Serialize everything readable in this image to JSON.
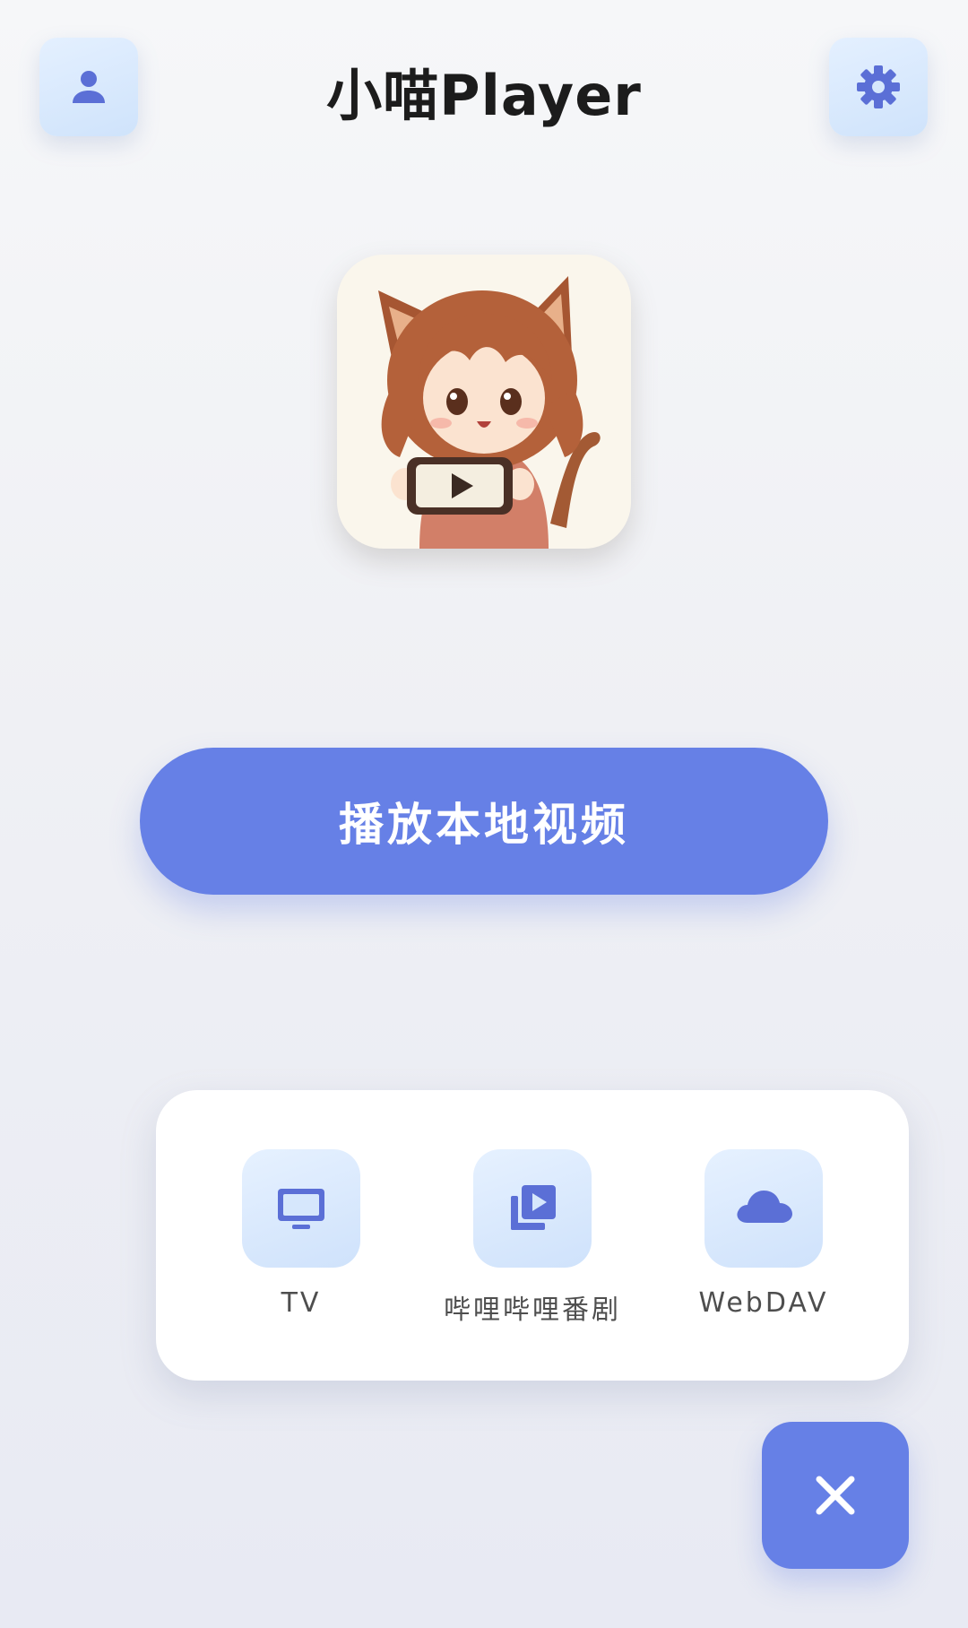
{
  "header": {
    "title": "小喵Player",
    "left_icon": "user-icon",
    "right_icon": "gear-icon"
  },
  "logo": {
    "icon": "cat-girl-holding-video-player-icon"
  },
  "primary_action": {
    "label": "播放本地视频"
  },
  "source_menu": {
    "items": [
      {
        "label": "TV",
        "icon": "tv-icon"
      },
      {
        "label": "哔哩哔哩番剧",
        "icon": "video-library-icon"
      },
      {
        "label": "WebDAV",
        "icon": "cloud-icon"
      }
    ]
  },
  "fab": {
    "icon": "close-icon"
  },
  "colors": {
    "accent": "#6680e6",
    "icon_tile": "#d6e7fc",
    "icon": "#5b6fd6",
    "card": "#ffffff"
  }
}
